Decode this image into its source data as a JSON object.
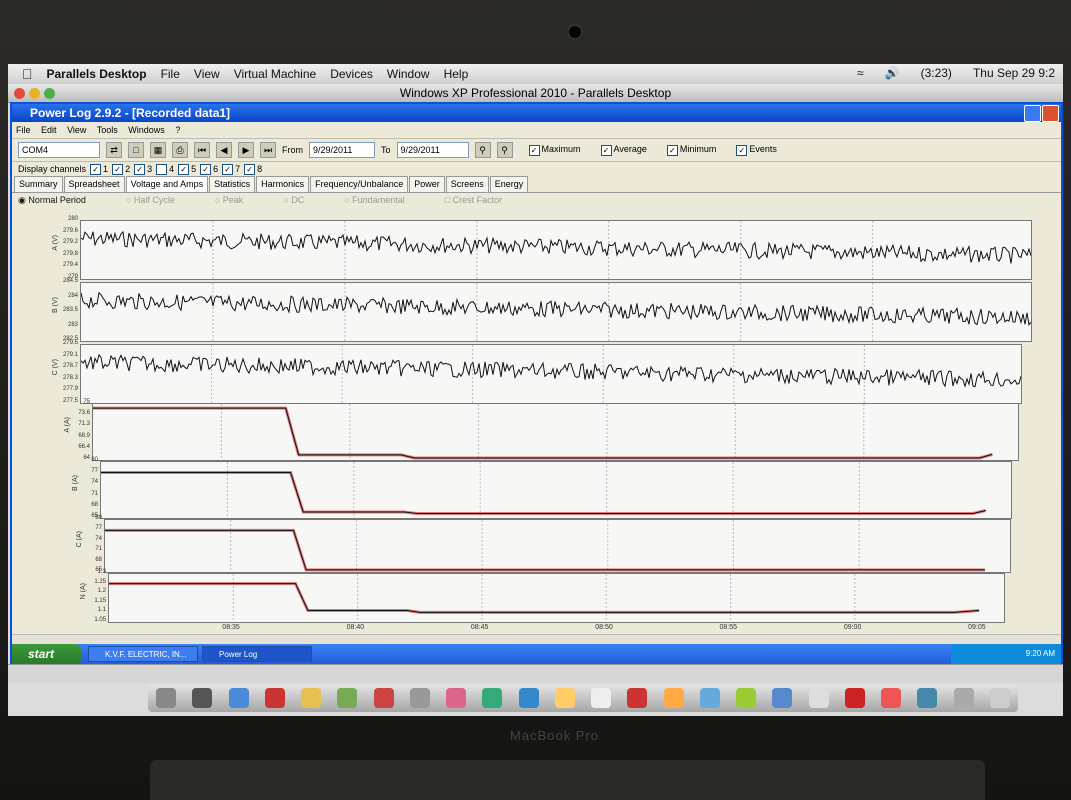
{
  "mac_menu": {
    "app_name": "Parallels Desktop",
    "items": [
      "File",
      "View",
      "Virtual Machine",
      "Devices",
      "Window",
      "Help"
    ],
    "battery": "(3:23)",
    "clock": "Thu Sep 29  9:2"
  },
  "parallels_window": {
    "title": "Windows XP Professional 2010 - Parallels Desktop"
  },
  "app": {
    "title": "Power Log 2.9.2 - [Recorded data1]",
    "menu": [
      "File",
      "Edit",
      "View",
      "Tools",
      "Windows",
      "?"
    ],
    "port": "COM4",
    "from_label": "From",
    "from_date": "9/29/2011",
    "to_label": "To",
    "to_date": "9/29/2011",
    "checks": [
      "Maximum",
      "Average",
      "Minimum",
      "Events"
    ],
    "display_channels_label": "Display channels",
    "channels": [
      "1",
      "2",
      "3",
      "4",
      "5",
      "6",
      "7",
      "8"
    ],
    "tabs": [
      "Summary",
      "Spreadsheet",
      "Voltage and Amps",
      "Statistics",
      "Harmonics",
      "Frequency/Unbalance",
      "Power",
      "Screens",
      "Energy"
    ],
    "modes": [
      "Normal Period",
      "Half Cycle",
      "Peak",
      "DC",
      "Fundamental",
      "Crest Factor"
    ]
  },
  "chart_data": [
    {
      "type": "line",
      "ylabel": "A (V)",
      "yticks": [
        "280",
        "279.6",
        "279.2",
        "279.8",
        "279.4",
        "279"
      ],
      "trend": "noisy, slowly declining"
    },
    {
      "type": "line",
      "ylabel": "B (V)",
      "yticks": [
        "284.5",
        "284",
        "283.5",
        "283",
        "282.5"
      ],
      "trend": "noisy, slowly declining"
    },
    {
      "type": "line",
      "ylabel": "C (V)",
      "yticks": [
        "279.5",
        "279.1",
        "278.7",
        "278.3",
        "277.9",
        "277.5"
      ],
      "trend": "noisy, slowly declining"
    },
    {
      "type": "line",
      "ylabel": "A (A)",
      "yticks": [
        "75",
        "73.6",
        "71.3",
        "68.9",
        "66.4",
        "64"
      ],
      "x": [
        "08:33",
        "08:40.5",
        "08:41",
        "08:45",
        "08:45.5",
        "09:07.5",
        "09:08"
      ],
      "y": [
        74.2,
        74.2,
        65.0,
        65.0,
        64.4,
        64.4,
        65.1
      ]
    },
    {
      "type": "line",
      "ylabel": "B (A)",
      "yticks": [
        "80",
        "77",
        "74",
        "71",
        "68",
        "65"
      ],
      "x": [
        "08:33",
        "08:40.5",
        "08:41",
        "08:45",
        "08:45.5",
        "09:07.5",
        "09:08"
      ],
      "y": [
        77.2,
        77.2,
        66.6,
        66.6,
        66.2,
        66.2,
        67.0
      ]
    },
    {
      "type": "line",
      "ylabel": "C (A)",
      "yticks": [
        "80",
        "77",
        "74",
        "71",
        "68",
        "65"
      ],
      "x": [
        "08:33",
        "08:40.5",
        "08:41",
        "09:08"
      ],
      "y": [
        77.0,
        77.0,
        65.6,
        65.6
      ]
    },
    {
      "type": "line",
      "ylabel": "N (A)",
      "yticks": [
        "1.3",
        "1.25",
        "1.2",
        "1.15",
        "1.1",
        "1.05"
      ],
      "x": [
        "08:33",
        "08:40.5",
        "08:41",
        "08:45",
        "08:45.5",
        "09:07",
        "09:08"
      ],
      "y": [
        1.25,
        1.25,
        1.11,
        1.11,
        1.1,
        1.1,
        1.11
      ]
    }
  ],
  "x_axis": {
    "ticks": [
      "08:35",
      "08:40",
      "08:45",
      "08:50",
      "08:55",
      "09:00",
      "09:05"
    ]
  },
  "taskbar": {
    "start": "start",
    "tasks": [
      "K.V.F. ELECTRIC, IN...",
      "Power Log"
    ],
    "clock": "9:20 AM"
  },
  "colors": {
    "xp_blue": "#0a53d9",
    "trace": "#111111",
    "trace_minmax": "#c00000"
  }
}
